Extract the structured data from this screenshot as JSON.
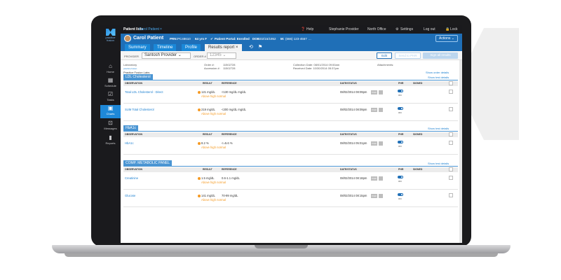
{
  "topbar": {
    "patient_lists": "Patient lists",
    "current_tab": "Carol Patient",
    "close": "×",
    "help": "Help",
    "user": "Stephanie Provider",
    "office": "North Office",
    "settings": "Settings",
    "logout": "Log out",
    "lock": "Lock"
  },
  "sidebar": {
    "logo_text": "practice fusion",
    "items": [
      {
        "label": "Home",
        "icon": "home-icon"
      },
      {
        "label": "Schedule",
        "icon": "calendar-icon"
      },
      {
        "label": "Tasks",
        "icon": "check-icon"
      },
      {
        "label": "Charts",
        "icon": "person-icon"
      },
      {
        "label": "Messages",
        "icon": "inbox-icon"
      },
      {
        "label": "Reports",
        "icon": "bar-chart-icon"
      }
    ]
  },
  "patient": {
    "name": "Carol Patient",
    "prn_label": "PRN:",
    "prn": "PC48610",
    "age_sex": "64 yrs F",
    "portal": "Patient Portal: Enrolled",
    "dob_label": "DOB:",
    "dob": "02/15/1952",
    "phone_label": "M:",
    "phone": "(666) 123-4567",
    "more": "...",
    "actions": "Actions"
  },
  "tabs": [
    "Summary",
    "Timeline",
    "Profile",
    "Results report ×"
  ],
  "filter": {
    "provider_label": "PROVIDER",
    "provider": "Santosh Provider",
    "order_label": "ORDER #",
    "order": "12345",
    "edit": "Edit",
    "send_phr": "Send to PHR",
    "sign_all": "Sign all results"
  },
  "report": {
    "laboratory_label": "Laboratory",
    "lab_name": "Practice Fusion Labs",
    "order_label": "Order #:",
    "order": "11502728",
    "accession_label": "Accession #:",
    "accession": "11502728",
    "collection": "Collection Date: 08/01/2014 09:00am",
    "received": "Received Date: 10/30/2014 05:37pm",
    "attachments": "Attachments:",
    "show_order": "Show order details",
    "show_test": "Show test details"
  },
  "columns": {
    "observation": "OBSERVATION",
    "result": "RESULT",
    "reference": "REFERENCE",
    "date": "DATE/STATUS",
    "phr": "PHR",
    "signed": "SIGNED"
  },
  "sections": [
    {
      "title": "LDL Cholesterol",
      "rows": [
        {
          "name": "Total LDL Cholesterol - Direct",
          "result": "121 mg/dL",
          "flag": "Above high normal",
          "ref": "<130 mg/dL mg/dL",
          "date": "08/02/2014 08:09pm",
          "phr": "ON"
        },
        {
          "name": "SUM Total Cholesterol",
          "result": "219 mg/dL",
          "flag": "Above high normal",
          "ref": "<200 mg/dL mg/dL",
          "date": "08/02/2014 08:09pm",
          "phr": "ON"
        }
      ]
    },
    {
      "title": "HbA1c",
      "rows": [
        {
          "name": "HbA1c",
          "result": "8.2 %",
          "flag": "Above high normal",
          "ref": "<=5.6 %",
          "date": "08/02/2014 05:01pm",
          "phr": "ON"
        }
      ]
    },
    {
      "title": "COMP. METABOLIC PANEL",
      "rows": [
        {
          "name": "Creatinine",
          "result": "1.5 mg/dL",
          "flag": "Above high normal",
          "ref": "0.6-1.1 mg/dL",
          "date": "08/02/2014 08:18pm",
          "phr": "ON"
        },
        {
          "name": "Glucose",
          "result": "141 mg/dL",
          "flag": "Above high normal",
          "ref": "70-99 mg/dL",
          "date": "08/02/2014 08:15pm",
          "phr": "ON"
        }
      ]
    }
  ],
  "badges": {
    "phr_mini": "PHR"
  },
  "colors": {
    "brand_blue": "#1f6fb7",
    "accent": "#1a88d8",
    "abnormal": "#f59a23",
    "sidebar": "#1a1a1d"
  }
}
